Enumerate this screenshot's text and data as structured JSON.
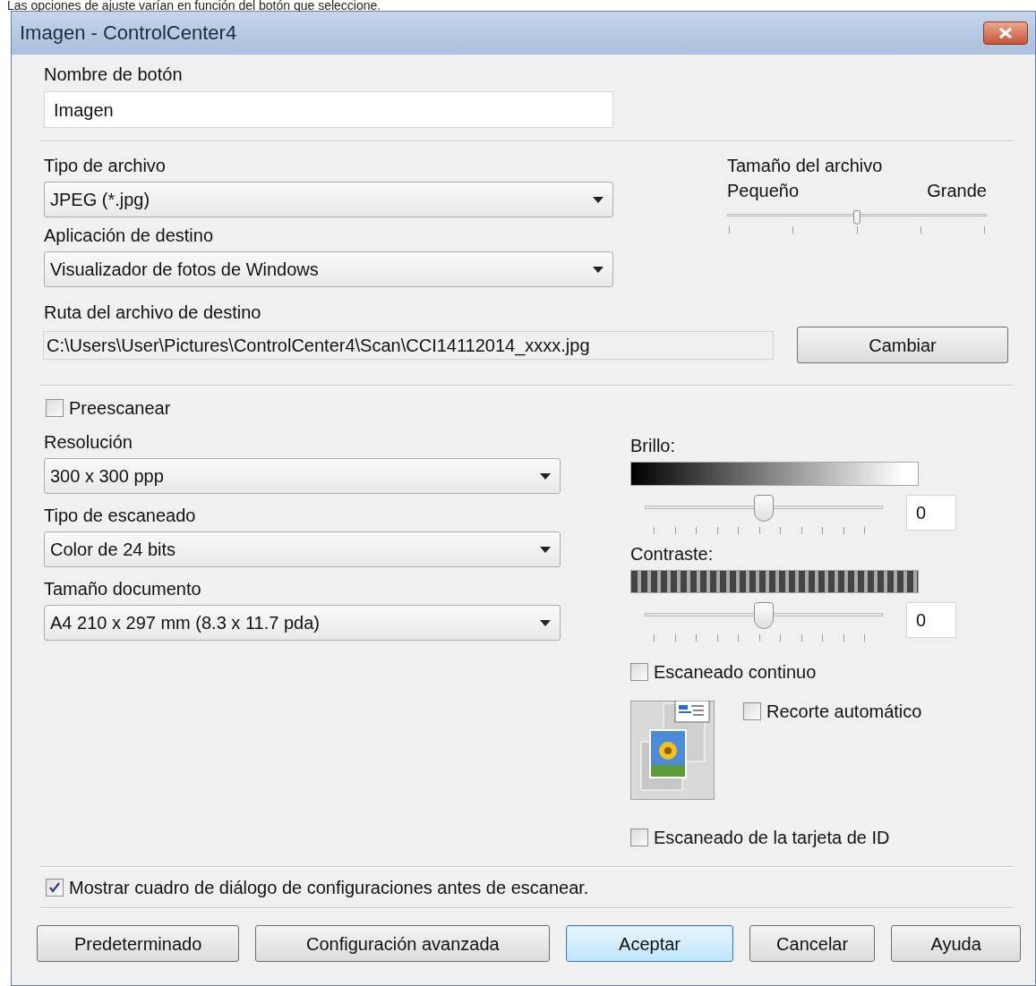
{
  "caption": "Las opciones de ajuste varían en función del botón que seleccione.",
  "window": {
    "title": "Imagen - ControlCenter4"
  },
  "button_name": {
    "label": "Nombre de botón",
    "value": "Imagen"
  },
  "file_type": {
    "label": "Tipo de archivo",
    "value": "JPEG (*.jpg)"
  },
  "file_size": {
    "label": "Tamaño del archivo",
    "min_label": "Pequeño",
    "max_label": "Grande",
    "level": 0.5
  },
  "destination_app": {
    "label": "Aplicación de destino",
    "value": "Visualizador de fotos de Windows"
  },
  "destination_path": {
    "label": "Ruta del archivo de destino",
    "value": "C:\\Users\\User\\Pictures\\ControlCenter4\\Scan\\CCI14112014_xxxx.jpg",
    "button": "Cambiar"
  },
  "prescan": {
    "label": "Preescanear",
    "checked": false
  },
  "selects": [
    {
      "label": "Resolución",
      "value": "300 x 300 ppp"
    },
    {
      "label": "Tipo de escaneado",
      "value": "Color de 24 bits"
    },
    {
      "label": "Tamaño documento",
      "value": "A4 210 x 297 mm (8.3 x 11.7 pda)"
    }
  ],
  "adjustments": [
    {
      "kind": "brightness",
      "label": "Brillo:",
      "level": 0.5,
      "value": "0"
    },
    {
      "kind": "contrast",
      "label": "Contraste:",
      "level": 0.5,
      "value": "0"
    }
  ],
  "continuous_scan": {
    "label": "Escaneado continuo",
    "checked": false
  },
  "auto_crop": {
    "label": "Recorte automático",
    "checked": false
  },
  "id_card_scan": {
    "label": "Escaneado de la tarjeta de ID",
    "checked": false
  },
  "show_dialog": {
    "label": "Mostrar cuadro de diálogo de configuraciones antes de escanear.",
    "checked": true
  },
  "buttons": [
    {
      "label": "Predeterminado",
      "default": false
    },
    {
      "label": "Configuración avanzada",
      "default": false
    },
    {
      "label": "Aceptar",
      "default": true
    },
    {
      "label": "Cancelar",
      "default": false
    },
    {
      "label": "Ayuda",
      "default": false
    }
  ]
}
